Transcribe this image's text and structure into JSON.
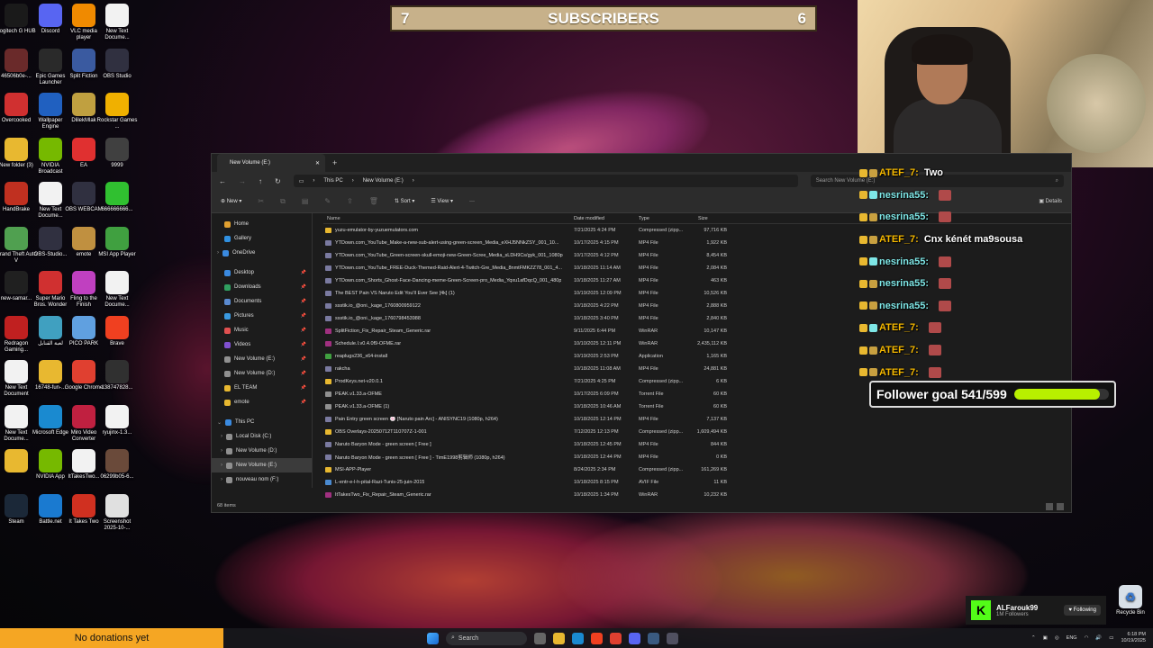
{
  "desktop_icons": [
    {
      "label": "Logitech G HUB",
      "icon": "logitech-icon",
      "color": "#1a1a1a"
    },
    {
      "label": "Discord",
      "icon": "discord-icon",
      "color": "#5865f2"
    },
    {
      "label": "VLC media player",
      "icon": "vlc-icon",
      "color": "#f08a00"
    },
    {
      "label": "New Text Docume...",
      "icon": "text-document-icon",
      "color": "#f2f2f2"
    },
    {
      "label": "46506b0e-...",
      "icon": "image-file-icon",
      "color": "#6a2a2a"
    },
    {
      "label": "Epic Games Launcher",
      "icon": "epic-games-icon",
      "color": "#2a2a2a"
    },
    {
      "label": "Split Fiction",
      "icon": "split-fiction-icon",
      "color": "#3a5aa0"
    },
    {
      "label": "OBS Studio",
      "icon": "obs-icon",
      "color": "#303040"
    },
    {
      "label": "Overcooked",
      "icon": "overcooked-icon",
      "color": "#d03030"
    },
    {
      "label": "Wallpaper Engine",
      "icon": "wallpaper-engine-icon",
      "color": "#2060c0"
    },
    {
      "label": "DlilekMlak",
      "icon": "game-icon",
      "color": "#c0a040"
    },
    {
      "label": "Rockstar Games ...",
      "icon": "rockstar-icon",
      "color": "#f0b000"
    },
    {
      "label": "New folder (3)",
      "icon": "folder-icon",
      "color": "#e8b830"
    },
    {
      "label": "NVIDIA Broadcast",
      "icon": "nvidia-icon",
      "color": "#76b900"
    },
    {
      "label": "EA",
      "icon": "ea-icon",
      "color": "#e03030"
    },
    {
      "label": "9999",
      "icon": "image-file-icon",
      "color": "#404040"
    },
    {
      "label": "HandBrake",
      "icon": "handbrake-icon",
      "color": "#c03020"
    },
    {
      "label": "New Text Docume...",
      "icon": "text-document-icon",
      "color": "#f2f2f2"
    },
    {
      "label": "OBS WEBCAM",
      "icon": "obs-icon",
      "color": "#303040"
    },
    {
      "label": "666666666...",
      "icon": "image-file-icon",
      "color": "#30c030"
    },
    {
      "label": "Grand Theft Auto V",
      "icon": "gta-icon",
      "color": "#50a050"
    },
    {
      "label": "OBS-Studio...",
      "icon": "obs-icon",
      "color": "#303040"
    },
    {
      "label": "emote",
      "icon": "image-file-icon",
      "color": "#c09040"
    },
    {
      "label": "MSI App Player",
      "icon": "msi-icon",
      "color": "#40a040"
    },
    {
      "label": "new-samar...",
      "icon": "video-file-icon",
      "color": "#202020"
    },
    {
      "label": "Super Mario Bros. Wonder",
      "icon": "mario-icon",
      "color": "#d03030"
    },
    {
      "label": "Fling to the Finish",
      "icon": "game-icon",
      "color": "#c040c0"
    },
    {
      "label": "New Text Docume...",
      "icon": "text-document-icon",
      "color": "#f2f2f2"
    },
    {
      "label": "Redragon Gaming...",
      "icon": "redragon-icon",
      "color": "#c02020"
    },
    {
      "label": "لعبة القنابل",
      "icon": "game-icon",
      "color": "#40a0c0"
    },
    {
      "label": "PICO PARK",
      "icon": "pico-park-icon",
      "color": "#60a0e0"
    },
    {
      "label": "Brave",
      "icon": "brave-icon",
      "color": "#f04020"
    },
    {
      "label": "New Text Document",
      "icon": "text-document-icon",
      "color": "#f2f2f2"
    },
    {
      "label": "16748-fun-...",
      "icon": "folder-icon",
      "color": "#e8b830"
    },
    {
      "label": "Google Chrome",
      "icon": "chrome-icon",
      "color": "#e04030"
    },
    {
      "label": "138747828...",
      "icon": "video-file-icon",
      "color": "#303030"
    },
    {
      "label": "New Text Docume...",
      "icon": "text-document-icon",
      "color": "#f2f2f2"
    },
    {
      "label": "Microsoft Edge",
      "icon": "edge-icon",
      "color": "#1a8ad0"
    },
    {
      "label": "Miro Video Converter",
      "icon": "video-converter-icon",
      "color": "#c02040"
    },
    {
      "label": "ryujinx-1.3...",
      "icon": "text-document-icon",
      "color": "#f2f2f2"
    },
    {
      "label": "",
      "icon": "folder-icon",
      "color": "#e8b830"
    },
    {
      "label": "NVIDIA App",
      "icon": "nvidia-icon",
      "color": "#76b900"
    },
    {
      "label": "ItTakesTwo...",
      "icon": "text-document-icon",
      "color": "#f2f2f2"
    },
    {
      "label": "06299b05-6...",
      "icon": "image-file-icon",
      "color": "#6a4a3a"
    },
    {
      "label": "Steam",
      "icon": "steam-icon",
      "color": "#1b2838"
    },
    {
      "label": "Battle.net",
      "icon": "battlenet-icon",
      "color": "#1a7ad0"
    },
    {
      "label": "It Takes Two",
      "icon": "it-takes-two-icon",
      "color": "#d03020"
    },
    {
      "label": "Screenshot 2025-10-...",
      "icon": "image-file-icon",
      "color": "#e0e0e0"
    }
  ],
  "overlay": {
    "subscribers_left": "7",
    "subscribers_label": "SUBSCRIBERS",
    "subscribers_right": "6",
    "follower_goal_label": "Follower goal 541/599",
    "follower_goal_progress": 0.903,
    "donations": "No donations yet"
  },
  "chat": [
    {
      "user": "ATEF_7:",
      "message": "Two",
      "user_color": "#f5b800"
    },
    {
      "user": "nesrina55:",
      "message": "",
      "user_color": "#7ee6e6"
    },
    {
      "user": "nesrina55:",
      "message": "",
      "user_color": "#7ee6e6"
    },
    {
      "user": "ATEF_7:",
      "message": "Cnx kénét ma9sousa",
      "user_color": "#f5b800"
    },
    {
      "user": "nesrina55:",
      "message": "",
      "user_color": "#7ee6e6"
    },
    {
      "user": "nesrina55:",
      "message": "",
      "user_color": "#7ee6e6"
    },
    {
      "user": "nesrina55:",
      "message": "",
      "user_color": "#7ee6e6"
    },
    {
      "user": "ATEF_7:",
      "message": "",
      "user_color": "#f5b800"
    },
    {
      "user": "ATEF_7:",
      "message": "",
      "user_color": "#f5b800"
    },
    {
      "user": "ATEF_7:",
      "message": "",
      "user_color": "#f5b800"
    }
  ],
  "kick_card": {
    "logo": "K",
    "channel": "ALFarouk99",
    "followers": "1M Followers",
    "follow_button": "Following",
    "accent": "#53fc18"
  },
  "explorer": {
    "tab_title": "New Volume (E:)",
    "address_parts": [
      "This PC",
      "New Volume (E:)"
    ],
    "search_placeholder": "Search New Volume (E:)",
    "toolbar": {
      "new": "New",
      "sort": "Sort",
      "view": "View",
      "more": "···",
      "details": "Details"
    },
    "nav": {
      "quick": [
        {
          "label": "Home",
          "color": "#e0a030"
        },
        {
          "label": "Gallery",
          "color": "#3090e0"
        },
        {
          "label": "OneDrive",
          "color": "#3a8ae0"
        }
      ],
      "pinned": [
        {
          "label": "Desktop",
          "color": "#3a8ae0"
        },
        {
          "label": "Downloads",
          "color": "#30a060"
        },
        {
          "label": "Documents",
          "color": "#5a8ad0"
        },
        {
          "label": "Pictures",
          "color": "#3a9ae0"
        },
        {
          "label": "Music",
          "color": "#e05050"
        },
        {
          "label": "Videos",
          "color": "#8050d0"
        },
        {
          "label": "New Volume (E:)",
          "color": "#909090"
        },
        {
          "label": "New Volume (D:)",
          "color": "#909090"
        },
        {
          "label": "EL TEAM",
          "color": "#e8b830"
        },
        {
          "label": "emote",
          "color": "#e8b830"
        }
      ],
      "this_pc": "This PC",
      "drives": [
        {
          "label": "Local Disk (C:)",
          "selected": false
        },
        {
          "label": "New Volume (D:)",
          "selected": false
        },
        {
          "label": "New Volume (E:)",
          "selected": true
        },
        {
          "label": "nouveau nom (F:)",
          "selected": false
        }
      ]
    },
    "columns": {
      "name": "Name",
      "date": "Date modified",
      "type": "Type",
      "size": "Size"
    },
    "files": [
      {
        "name": "yuzu-emulator-by-yuzuemulators.com",
        "date": "7/21/2025 4:24 PM",
        "type": "Compressed (zipp...",
        "size": "97,716 KB",
        "color": "#e8b830"
      },
      {
        "name": "YTDown.com_YouTube_Make-a-new-sub-alert-using-green-screen_Media_eXHJ5NNkZSY_001_10...",
        "date": "10/17/2025 4:15 PM",
        "type": "MP4 File",
        "size": "1,922 KB",
        "color": "#7a7aa0"
      },
      {
        "name": "YTDown.com_YouTube_Green-screen-skull-emoji-new-Green-Scree_Media_sLDH9Cs/gyk_001_1080p",
        "date": "10/17/2025 4:12 PM",
        "type": "MP4 File",
        "size": "8,454 KB",
        "color": "#7a7aa0"
      },
      {
        "name": "YTDown.com_YouTube_FREE-Duck-Themed-Raid-Alert-4-Twitch-Gre_Media_8nmtFMKZZ78_001_4...",
        "date": "10/18/2025 11:14 AM",
        "type": "MP4 File",
        "size": "2,084 KB",
        "color": "#7a7aa0"
      },
      {
        "name": "YTDown.com_Shorts_Ghost-Face-Dancing-meme-Green-Screen-pro_Media_Yqxu1afDqcQ_001_480p",
        "date": "10/18/2025 11:27 AM",
        "type": "MP4 File",
        "size": "463 KB",
        "color": "#7a7aa0"
      },
      {
        "name": "The BEST Pain VS Naruto Edit You'll Ever See [4k] (1)",
        "date": "10/19/2025 12:09 PM",
        "type": "MP4 File",
        "size": "10,526 KB",
        "color": "#7a7aa0"
      },
      {
        "name": "ssstik.io_@oni._kage_1760800959122",
        "date": "10/18/2025 4:22 PM",
        "type": "MP4 File",
        "size": "2,888 KB",
        "color": "#7a7aa0"
      },
      {
        "name": "ssstik.io_@oni._kage_1760798453988",
        "date": "10/18/2025 3:40 PM",
        "type": "MP4 File",
        "size": "2,840 KB",
        "color": "#7a7aa0"
      },
      {
        "name": "SplitFiction_Fix_Repair_Steam_Generic.rar",
        "date": "9/11/2025 6:44 PM",
        "type": "WinRAR",
        "size": "10,147 KB",
        "color": "#a03080"
      },
      {
        "name": "Schedule.I.v0.4.0f9-OFME.rar",
        "date": "10/10/2025 12:11 PM",
        "type": "WinRAR",
        "size": "2,435,112 KB",
        "color": "#a03080"
      },
      {
        "name": "reaplugs236_x64-install",
        "date": "10/19/2025 2:53 PM",
        "type": "Application",
        "size": "1,165 KB",
        "color": "#40a040"
      },
      {
        "name": "rakcha",
        "date": "10/18/2025 11:08 AM",
        "type": "MP4 File",
        "size": "24,881 KB",
        "color": "#7a7aa0"
      },
      {
        "name": "ProdKeys.net-v20.0.1",
        "date": "7/21/2025 4:25 PM",
        "type": "Compressed (zipp...",
        "size": "6 KB",
        "color": "#e8b830"
      },
      {
        "name": "PEAK.v1.33.a-OFME",
        "date": "10/17/2025 6:09 PM",
        "type": "Torrent File",
        "size": "60 KB",
        "color": "#909090"
      },
      {
        "name": "PEAK.v1.33.a-OFME (1)",
        "date": "10/18/2025 10:46 AM",
        "type": "Torrent File",
        "size": "60 KB",
        "color": "#909090"
      },
      {
        "name": "Pain Entry green screen 🍥 [Naruto pain Arc] - ANISYNC19 (1080p, h264)",
        "date": "10/18/2025 12:14 PM",
        "type": "MP4 File",
        "size": "7,137 KB",
        "color": "#7a7aa0"
      },
      {
        "name": "OBS Overlays-20250712T110707Z-1-001",
        "date": "7/12/2025 12:13 PM",
        "type": "Compressed (zipp...",
        "size": "1,609,494 KB",
        "color": "#e8b830"
      },
      {
        "name": "Naruto Baryon Mode - green screen [ Free ]",
        "date": "10/18/2025 12:45 PM",
        "type": "MP4 File",
        "size": "844 KB",
        "color": "#7a7aa0"
      },
      {
        "name": "Naruto Baryon Mode - green screen [ Free ] - TimE1998剪辑师 (1080p, h264)",
        "date": "10/18/2025 12:44 PM",
        "type": "MP4 File",
        "size": "0 KB",
        "color": "#7a7aa0"
      },
      {
        "name": "MSI-APP-Player",
        "date": "8/24/2025 2:34 PM",
        "type": "Compressed (zipp...",
        "size": "161,269 KB",
        "color": "#e8b830"
      },
      {
        "name": "L-entr-e-l-h-pital-Razi-Tunis-25-juin-2015",
        "date": "10/18/2025 8:15 PM",
        "type": "AVIF File",
        "size": "11 KB",
        "color": "#4a8ad0"
      },
      {
        "name": "ItTakesTwo_Fix_Repair_Steam_Generic.rar",
        "date": "10/18/2025 1:34 PM",
        "type": "WinRAR",
        "size": "10,232 KB",
        "color": "#a03080"
      }
    ],
    "status": "68 items"
  },
  "taskbar": {
    "search": "Search",
    "apps": [
      {
        "icon": "file-explorer-icon",
        "color": "#e8b830"
      },
      {
        "icon": "edge-icon",
        "color": "#1a8ad0"
      },
      {
        "icon": "brave-icon",
        "color": "#f04020"
      },
      {
        "icon": "chrome-icon",
        "color": "#e04030"
      },
      {
        "icon": "discord-icon",
        "color": "#5865f2"
      },
      {
        "icon": "steam-icon",
        "color": "#3a5a80"
      },
      {
        "icon": "obs-icon",
        "color": "#505060"
      }
    ],
    "language": "ENG",
    "time": "6:18 PM",
    "date": "10/19/2025"
  },
  "recycle_bin": "Recycle Bin"
}
